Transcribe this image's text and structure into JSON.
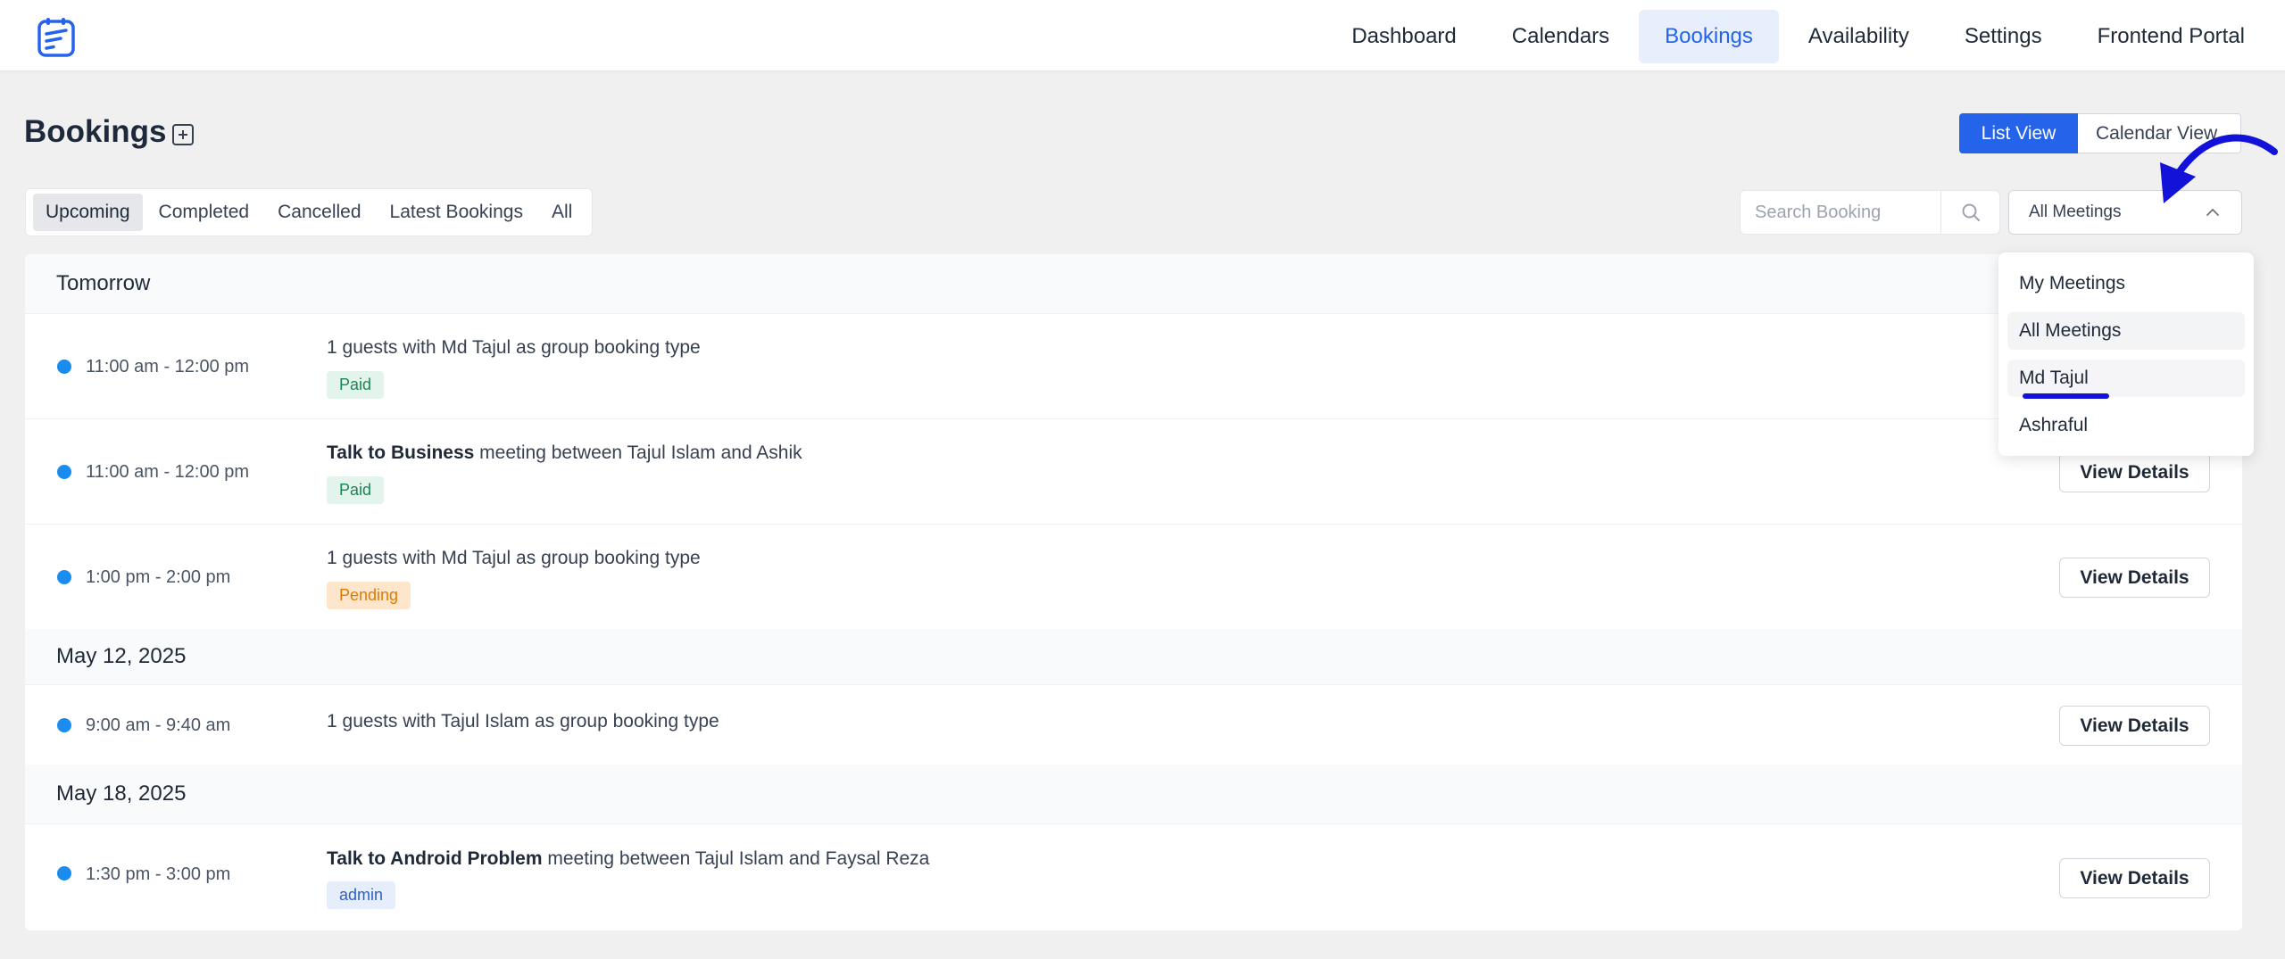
{
  "nav": {
    "items": [
      {
        "label": "Dashboard",
        "name": "dashboard"
      },
      {
        "label": "Calendars",
        "name": "calendars"
      },
      {
        "label": "Bookings",
        "name": "bookings",
        "active": true
      },
      {
        "label": "Availability",
        "name": "availability"
      },
      {
        "label": "Settings",
        "name": "settings"
      },
      {
        "label": "Frontend Portal",
        "name": "frontend-portal"
      }
    ]
  },
  "header": {
    "title": "Bookings",
    "list_view_label": "List View",
    "calendar_view_label": "Calendar View"
  },
  "tabs": [
    {
      "label": "Upcoming",
      "active": true
    },
    {
      "label": "Completed"
    },
    {
      "label": "Cancelled"
    },
    {
      "label": "Latest Bookings"
    },
    {
      "label": "All"
    }
  ],
  "search": {
    "placeholder": "Search Booking"
  },
  "filter": {
    "selected": "All Meetings",
    "options": [
      "My Meetings",
      "All Meetings",
      "Md Tajul",
      "Ashraful"
    ]
  },
  "groups": [
    {
      "date": "Tomorrow",
      "bookings": [
        {
          "time": "11:00 am - 12:00 pm",
          "title": "",
          "text": "1 guests with Md Tajul as group booking type",
          "badge": "Paid",
          "badge_type": "paid"
        },
        {
          "time": "11:00 am - 12:00 pm",
          "title": "Talk to Business",
          "text": " meeting between Tajul Islam and Ashik",
          "badge": "Paid",
          "badge_type": "paid",
          "action": "View Details"
        },
        {
          "time": "1:00 pm - 2:00 pm",
          "title": "",
          "text": "1 guests with Md Tajul as group booking type",
          "badge": "Pending",
          "badge_type": "pending",
          "action": "View Details"
        }
      ]
    },
    {
      "date": "May 12, 2025",
      "bookings": [
        {
          "time": "9:00 am - 9:40 am",
          "title": "",
          "text": "1 guests with Tajul Islam as group booking type",
          "action": "View Details"
        }
      ]
    },
    {
      "date": "May 18, 2025",
      "bookings": [
        {
          "time": "1:30 pm - 3:00 pm",
          "title": "Talk to Android Problem",
          "text": " meeting between Tajul Islam and Faysal Reza",
          "badge": "admin",
          "badge_type": "admin",
          "action": "View Details"
        }
      ]
    }
  ],
  "colors": {
    "accent": "#2563eb",
    "status_dot": "#1a8cf0",
    "annotation": "#1212d9"
  }
}
